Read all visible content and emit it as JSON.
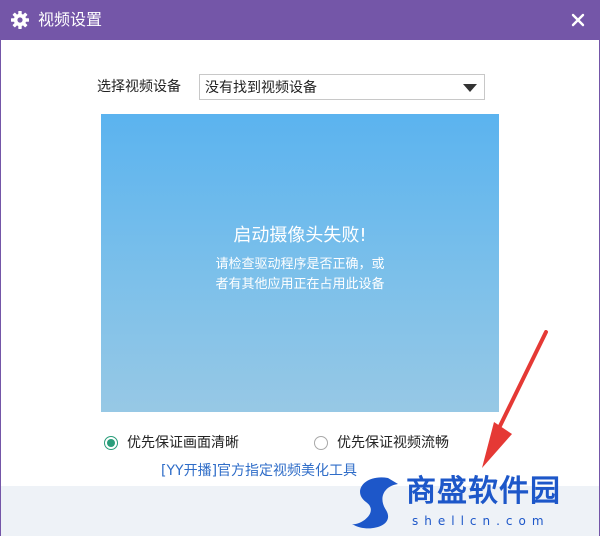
{
  "window": {
    "title": "视频设置",
    "title_icon": "gear-icon",
    "close_icon": "close-icon"
  },
  "device": {
    "label": "选择视频设备",
    "selected": "没有找到视频设备",
    "caret_icon": "caret-down-icon"
  },
  "preview": {
    "error_title": "启动摄像头失败!",
    "error_line1": "请检查驱动程序是否正确，或",
    "error_line2": "者有其他应用正在占用此设备"
  },
  "quality_options": [
    {
      "label": "优先保证画面清晰",
      "checked": true
    },
    {
      "label": "优先保证视频流畅",
      "checked": false
    }
  ],
  "promo_link": "[YY开播]官方指定视频美化工具",
  "watermark": {
    "text": "商盛软件园",
    "domain": "shellcn.com"
  },
  "colors": {
    "titlebar": "#7456a8",
    "preview_top": "#5bb3ef",
    "preview_bottom": "#97c8e5",
    "radio_checked": "#2a9d7a",
    "link": "#2f6dc8",
    "watermark": "#1d57c9",
    "arrow": "#e53935"
  }
}
